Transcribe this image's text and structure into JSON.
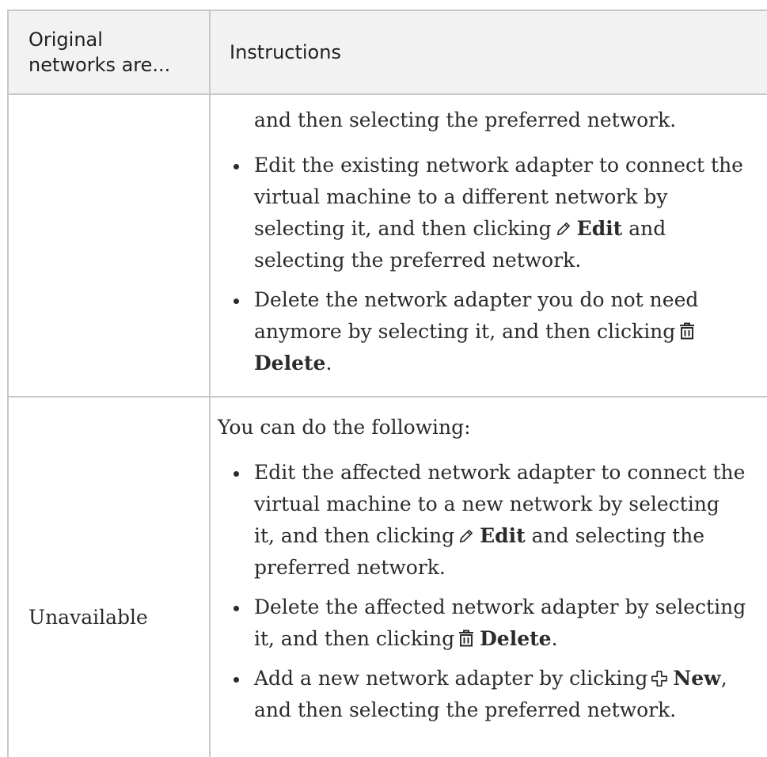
{
  "table": {
    "header": {
      "col1_line1": "Original",
      "col1_line2": "networks are...",
      "col2": "Instructions"
    },
    "row1": {
      "continuation": "and then selecting the preferred network.",
      "items": [
        {
          "line1": "Edit the existing network adapter to connect the",
          "line2": "virtual machine to a different network by",
          "line3_pre": "selecting it, and then clicking",
          "icon": "pencil-icon",
          "button": "Edit",
          "line3_post": "and",
          "line4": "selecting the preferred network."
        },
        {
          "line1": "Delete the network adapter you do not need",
          "line2_pre": "anymore by selecting it, and then clicking",
          "icon": "trash-icon",
          "button": "Delete",
          "post": "."
        }
      ]
    },
    "row2": {
      "label": "Unavailable",
      "intro": "You can do the following:",
      "items": [
        {
          "line1": "Edit the affected network adapter to connect the",
          "line2": "virtual machine to a new network by selecting",
          "line3_pre": "it, and then clicking",
          "icon": "pencil-icon",
          "button": "Edit",
          "line3_post": "and selecting the",
          "line4": "preferred network."
        },
        {
          "line1": "Delete the affected network adapter by selecting",
          "line2_pre": "it, and then clicking",
          "icon": "trash-icon",
          "button": "Delete",
          "post": "."
        },
        {
          "line1_pre": "Add a new network adapter by clicking",
          "icon": "plus-icon",
          "button": "New",
          "line1_post": ",",
          "line2": "and then selecting the preferred network."
        }
      ]
    }
  }
}
